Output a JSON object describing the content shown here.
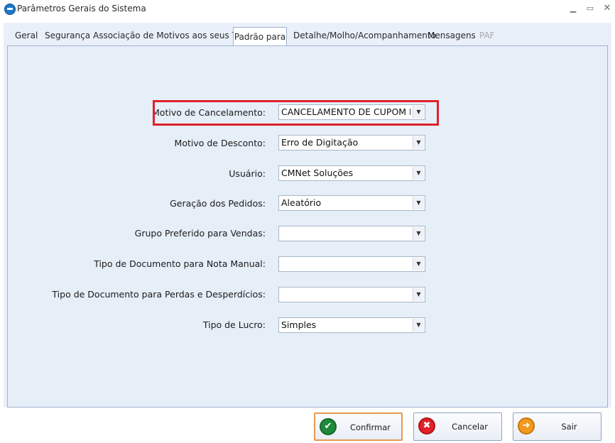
{
  "window": {
    "title": "Parâmetros Gerais do Sistema",
    "icons": [
      "app-icon",
      "minimize-icon",
      "maximize-icon",
      "close-icon"
    ]
  },
  "tabs": [
    {
      "label": "Geral"
    },
    {
      "label": "Segurança"
    },
    {
      "label": "Associação de Motivos aos seus Tipos"
    },
    {
      "label": "Padrão para",
      "active": true
    },
    {
      "label": "Detalhe/Molho/Acompanhamento"
    },
    {
      "label": "Mensagens"
    },
    {
      "label": "PAF",
      "disabled": true
    }
  ],
  "fields": [
    {
      "label": "Motivo de Cancelamento:",
      "value": "CANCELAMENTO DE CUPOM F"
    },
    {
      "label": "Motivo de Desconto:",
      "value": "Erro de Digitação"
    },
    {
      "label": "Usuário:",
      "value": "CMNet Soluções"
    },
    {
      "label": "Geração dos Pedidos:",
      "value": "Aleatório"
    },
    {
      "label": "Grupo Preferido para Vendas:",
      "value": ""
    },
    {
      "label": "Tipo de Documento para Nota Manual:",
      "value": ""
    },
    {
      "label": "Tipo de Documento para Perdas e Desperdícios:",
      "value": ""
    },
    {
      "label": "Tipo de Lucro:",
      "value": "Simples"
    }
  ],
  "buttons": {
    "confirm": {
      "label": "Confirmar",
      "icon": "check-icon",
      "color": "#1f8a3b"
    },
    "cancel": {
      "label": "Cancelar",
      "icon": "x-circle-icon",
      "color": "#e0202a"
    },
    "exit": {
      "label": "Sair",
      "icon": "exit-arrow-icon",
      "color": "#f39a1e"
    }
  },
  "colors": {
    "highlight": "#e0202a",
    "panel": "#e6eef8"
  }
}
